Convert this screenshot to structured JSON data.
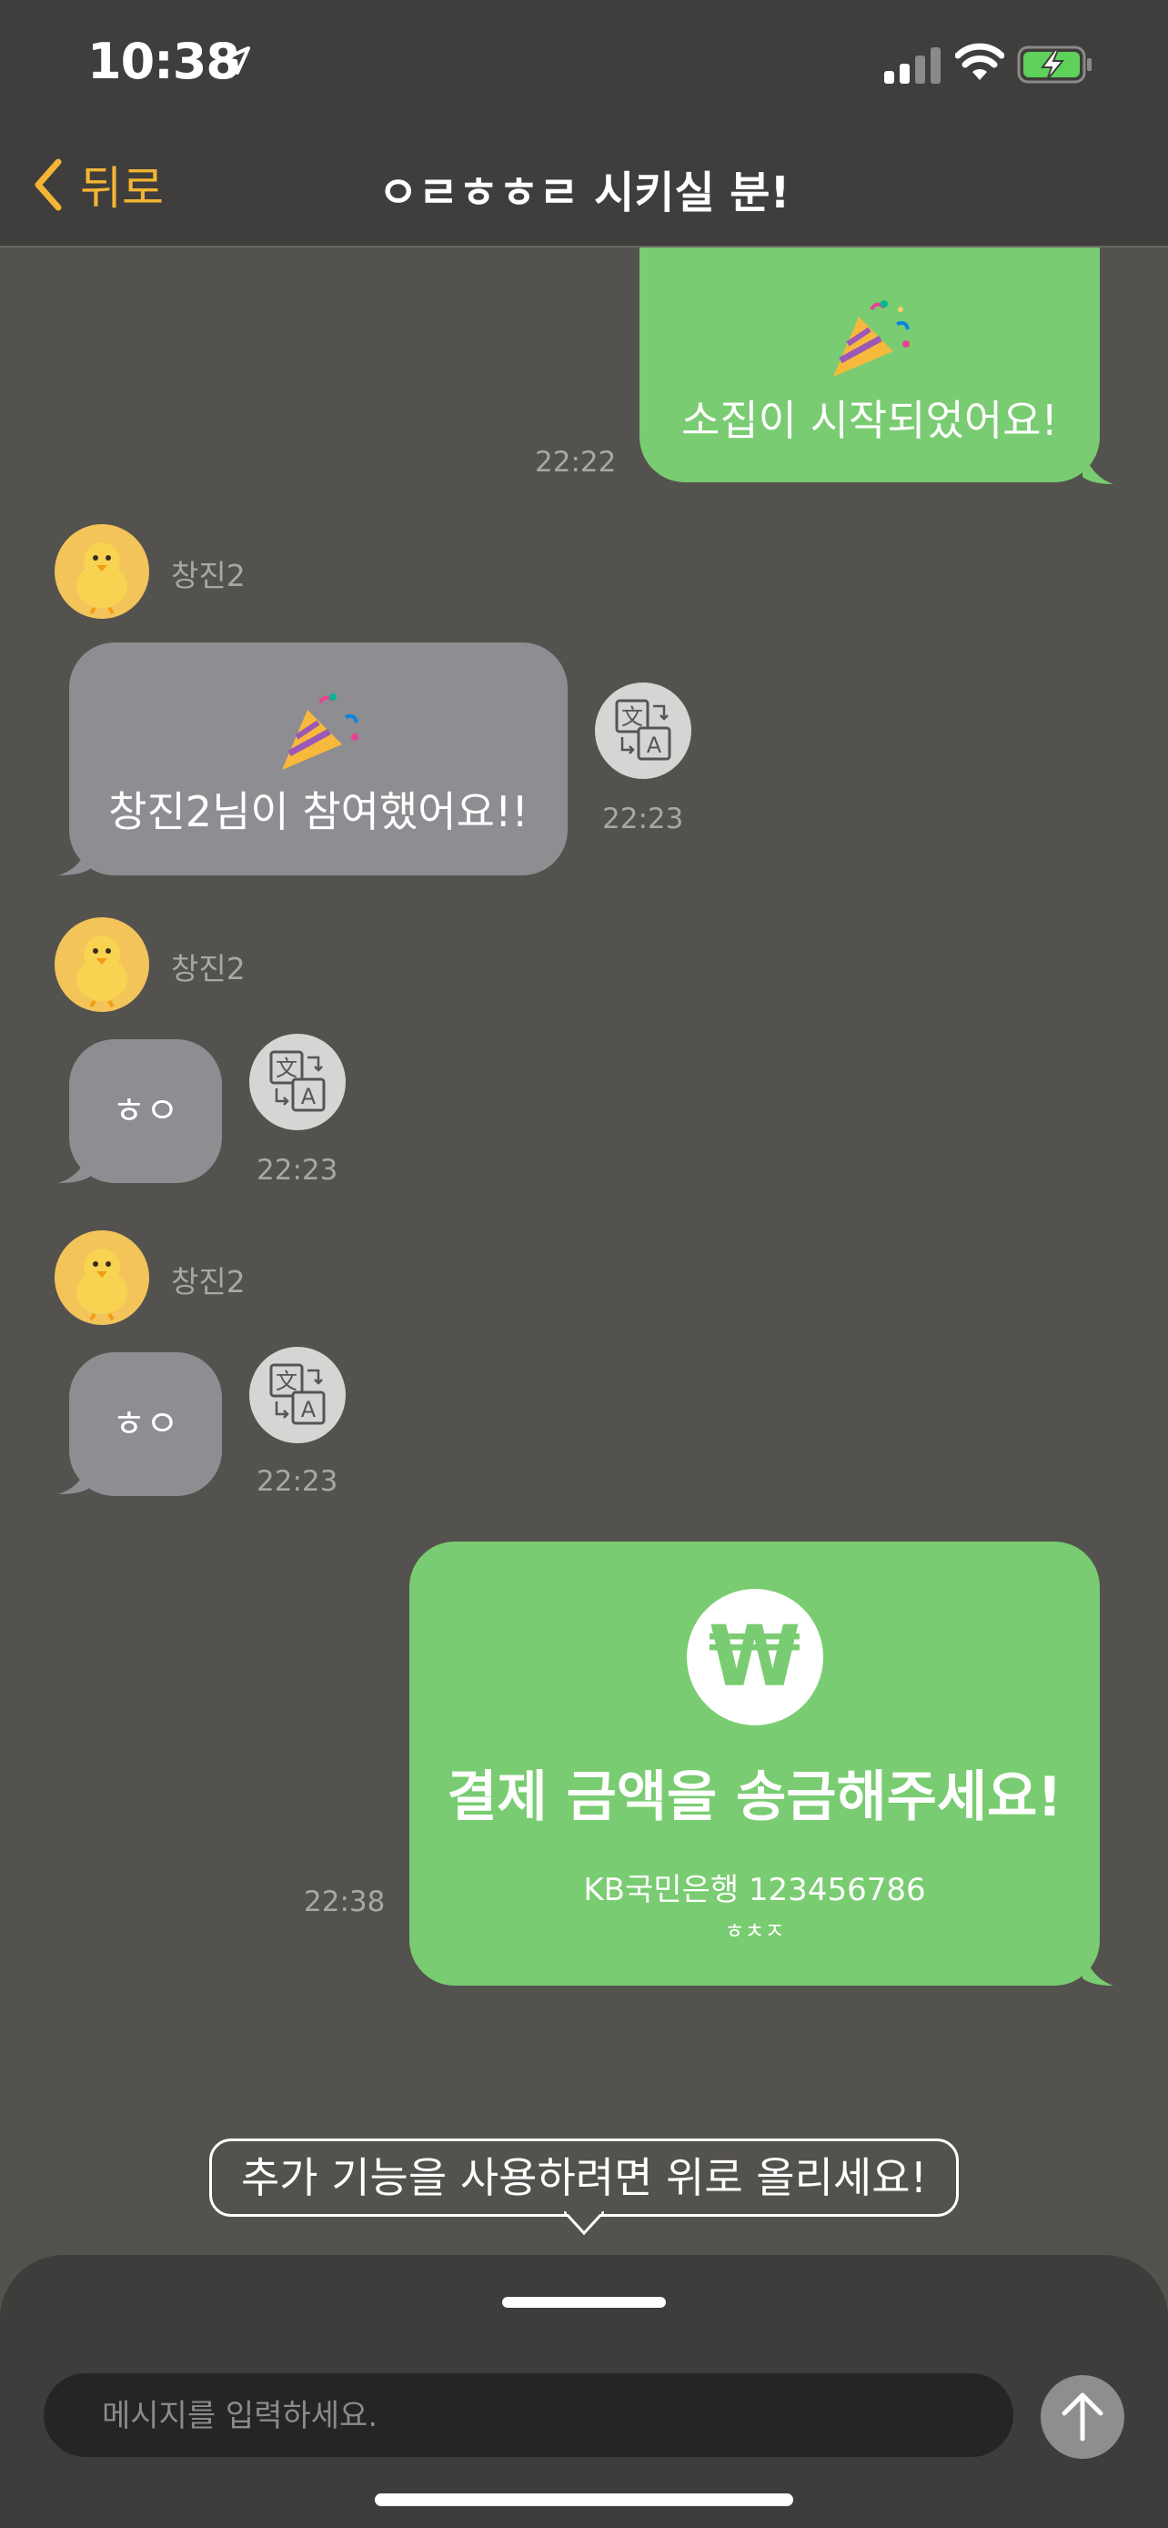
{
  "status_bar": {
    "time": "10:38",
    "battery_charging": true
  },
  "nav": {
    "back_label": "뒤로",
    "title": "ㅇㄹㅎㅎㄹ 시키실 분!"
  },
  "messages": [
    {
      "type": "system_outgoing",
      "text": "소집이 시작되었어요!",
      "time": "22:22"
    },
    {
      "type": "incoming",
      "sender": "창진2",
      "text": "창진2님이 참여했어요!!",
      "time": "22:23"
    },
    {
      "type": "incoming",
      "sender": "창진2",
      "text": "ㅎㅇ",
      "time": "22:23"
    },
    {
      "type": "incoming",
      "sender": "창진2",
      "text": "ㅎㅇ",
      "time": "22:23"
    },
    {
      "type": "payment_outgoing",
      "currency_symbol": "₩",
      "title": "결제 금액을 송금해주세요!",
      "account": "KB국민은행 123456786",
      "holder": "ㅎㅊㅈ",
      "time": "22:38"
    }
  ],
  "hint": "추가 기능을 사용하려면 위로 올리세요!",
  "composer": {
    "placeholder": "메시지를 입력하세요."
  },
  "colors": {
    "accent": "#f4b534",
    "bubble_out": "#79cc71",
    "bubble_in": "#8e8d91",
    "background": "#54524e"
  }
}
